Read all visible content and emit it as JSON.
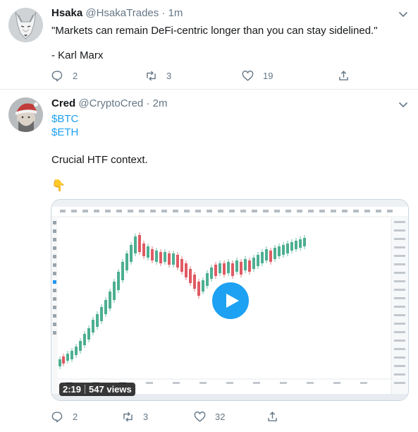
{
  "tweets": [
    {
      "display_name": "Hsaka",
      "handle": "@HsakaTrades",
      "time": "1m",
      "text_lines": [
        "\"Markets can remain DeFi-centric longer than you can stay sidelined.\"",
        "",
        "- Karl Marx"
      ],
      "replies": "2",
      "retweets": "3",
      "likes": "19"
    },
    {
      "display_name": "Cred",
      "handle": "@CryptoCred",
      "time": "2m",
      "cashtags": [
        "$BTC",
        "$ETH"
      ],
      "text": "Crucial HTF context.",
      "emoji": "👇",
      "video": {
        "duration": "2:19",
        "views": "547 views"
      },
      "replies": "2",
      "retweets": "3",
      "likes": "32"
    }
  ],
  "separator": "·",
  "colors": {
    "link": "#1da1f2",
    "muted": "#657786",
    "up_candle": "#4caf91",
    "down_candle": "#e05a63"
  }
}
